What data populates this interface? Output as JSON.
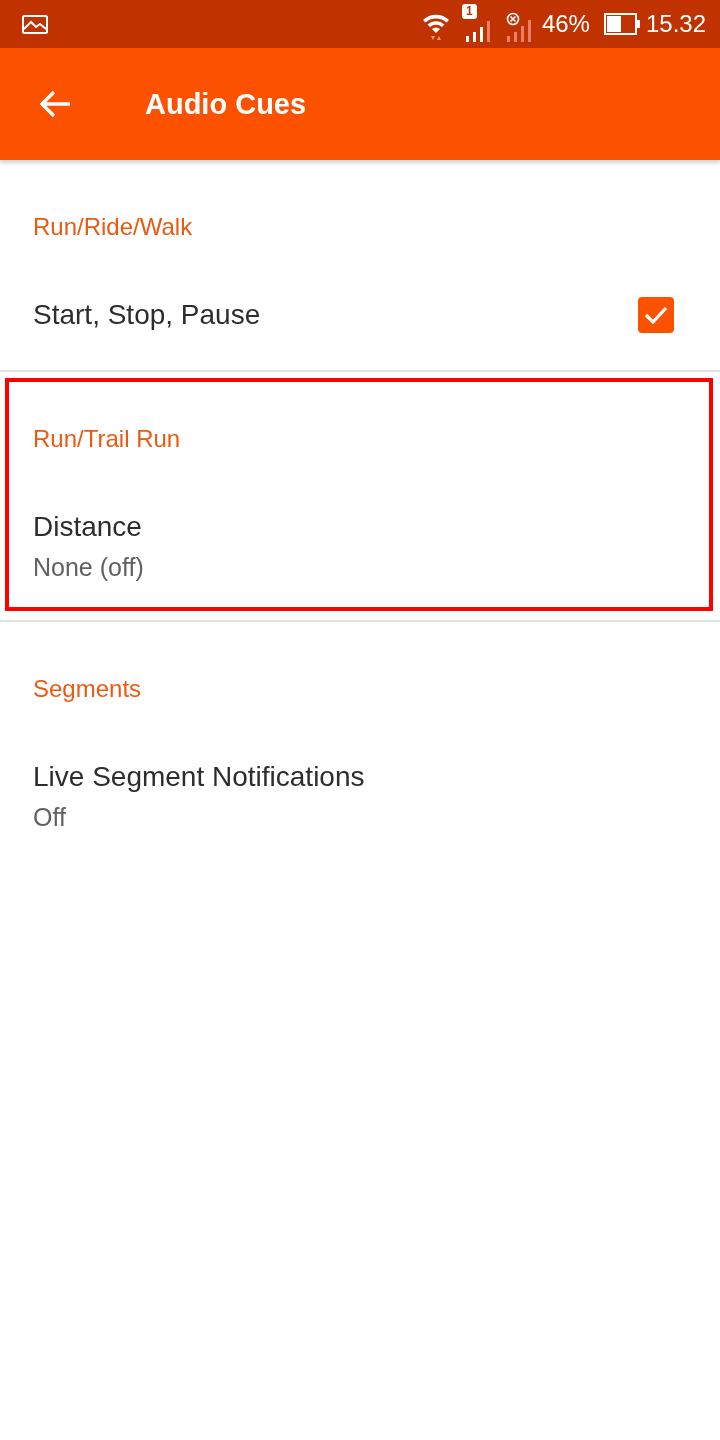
{
  "status_bar": {
    "sim_badge": "1",
    "battery": "46%",
    "time": "15.32"
  },
  "app_bar": {
    "title": "Audio Cues"
  },
  "sections": [
    {
      "header": "Run/Ride/Walk",
      "highlighted": false,
      "items": [
        {
          "kind": "checkbox",
          "title": "Start, Stop, Pause",
          "checked": true
        }
      ]
    },
    {
      "header": "Run/Trail Run",
      "highlighted": true,
      "items": [
        {
          "kind": "value",
          "title": "Distance",
          "summary": "None (off)"
        }
      ]
    },
    {
      "header": "Segments",
      "highlighted": false,
      "items": [
        {
          "kind": "value",
          "title": "Live Segment Notifications",
          "summary": "Off"
        }
      ]
    }
  ]
}
